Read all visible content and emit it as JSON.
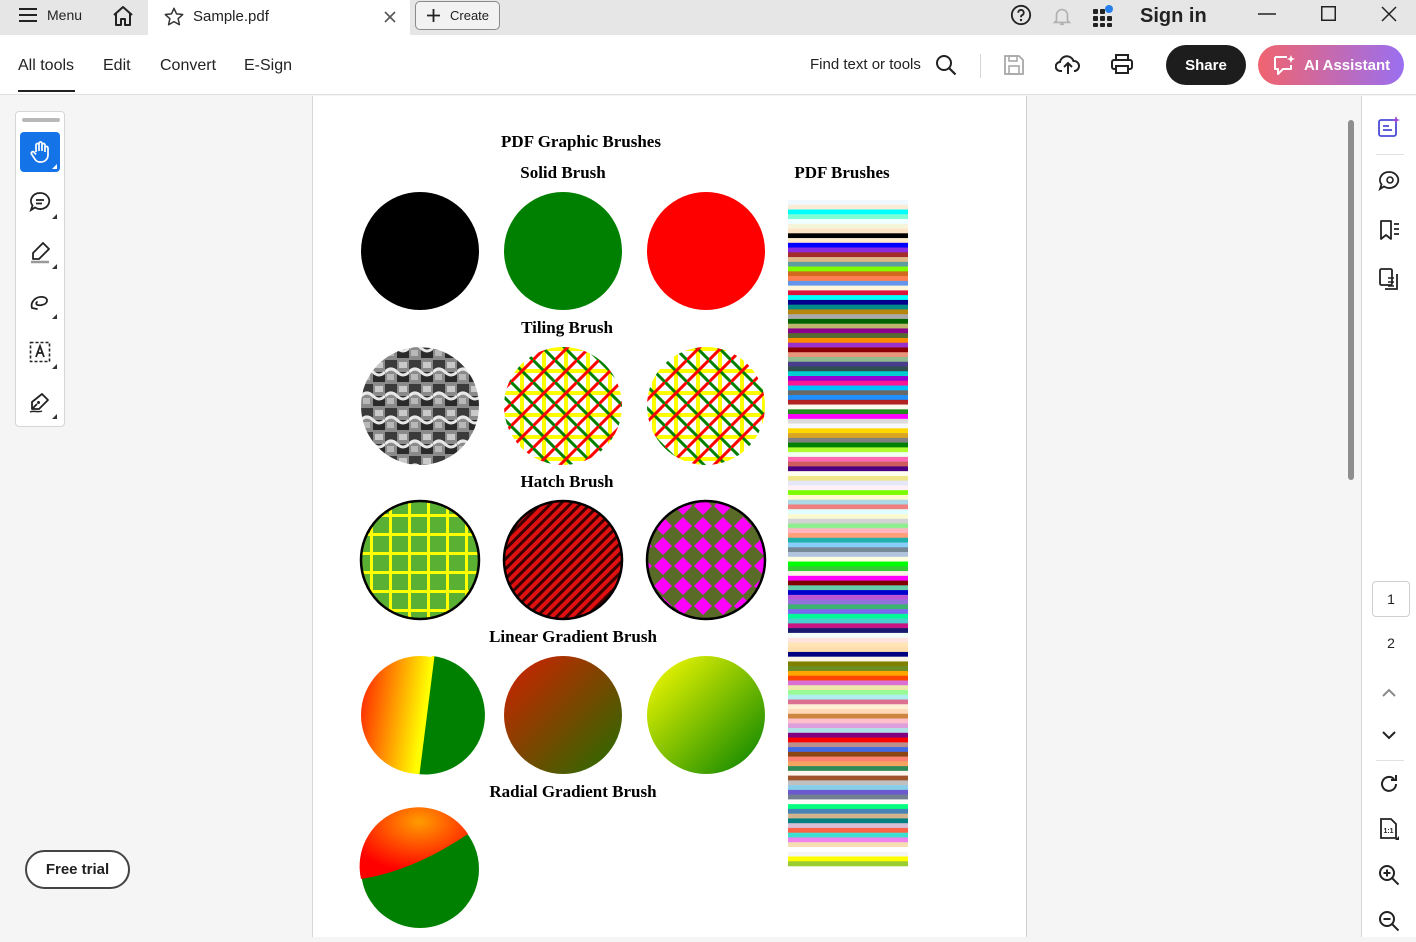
{
  "titlebar": {
    "menu_label": "Menu",
    "tab_label": "Sample.pdf",
    "create_label": "Create",
    "sign_in_label": "Sign in"
  },
  "toolbar": {
    "tabs": [
      {
        "label": "All tools",
        "active": true
      },
      {
        "label": "Edit",
        "active": false
      },
      {
        "label": "Convert",
        "active": false
      },
      {
        "label": "E-Sign",
        "active": false
      }
    ],
    "find_label": "Find text or tools",
    "share_label": "Share",
    "ai_label": "AI Assistant"
  },
  "left_panel": {
    "tools": [
      "hand-tool",
      "comment-tool",
      "highlight-tool",
      "draw-tool",
      "text-select-tool",
      "sign-tool"
    ],
    "free_trial_label": "Free trial"
  },
  "pdf": {
    "main_title": "PDF Graphic Brushes",
    "solid_title": "Solid Brush",
    "tiling_title": "Tiling Brush",
    "hatch_title": "Hatch Brush",
    "linear_title": "Linear Gradient Brush",
    "radial_title": "Radial Gradient Brush",
    "brushes_title": "PDF Brushes",
    "solid_colors": [
      "#000000",
      "#008000",
      "#ff0000"
    ],
    "stripe_colors": [
      "#f0f8ff",
      "#faebd7",
      "#00ffff",
      "#7fffd4",
      "#f0ffff",
      "#f5f5dc",
      "#ffe4c4",
      "#000000",
      "#ffebcd",
      "#0000ff",
      "#8a2be2",
      "#a52a2a",
      "#deb887",
      "#5f9ea0",
      "#7fff00",
      "#d2691e",
      "#ff7f50",
      "#6495ed",
      "#fff8dc",
      "#dc143c",
      "#00ffff",
      "#00008b",
      "#008b8b",
      "#b8860b",
      "#a9a9a9",
      "#006400",
      "#bdb76b",
      "#8b008b",
      "#556b2f",
      "#ff8c00",
      "#9932cc",
      "#8b0000",
      "#e9967a",
      "#8fbc8f",
      "#483d8b",
      "#2f4f4f",
      "#00ced1",
      "#9400d3",
      "#ff1493",
      "#00bfff",
      "#696969",
      "#1e90ff",
      "#b22222",
      "#fffaf0",
      "#228b22",
      "#ff00ff",
      "#dcdcdc",
      "#f8f8ff",
      "#ffd700",
      "#daa520",
      "#808080",
      "#008000",
      "#adff2f",
      "#f0fff0",
      "#ff69b4",
      "#cd5c5c",
      "#4b0082",
      "#fffff0",
      "#f0e68c",
      "#e6e6fa",
      "#fff0f5",
      "#7cfc00",
      "#fffacd",
      "#add8e6",
      "#f08080",
      "#e0ffff",
      "#fafad2",
      "#d3d3d3",
      "#90ee90",
      "#ffb6c1",
      "#ffa07a",
      "#20b2aa",
      "#87cefa",
      "#778899",
      "#b0c4de",
      "#ffffe0",
      "#00ff00",
      "#32cd32",
      "#faf0e6",
      "#ff00ff",
      "#800000",
      "#66cdaa",
      "#0000cd",
      "#ba55d3",
      "#9370db",
      "#3cb371",
      "#7b68ee",
      "#00fa9a",
      "#48d1cc",
      "#c71585",
      "#191970",
      "#f5fffa",
      "#ffe4e1",
      "#ffe4b5",
      "#ffdead",
      "#000080",
      "#fdf5e6",
      "#808000",
      "#6b8e23",
      "#ffa500",
      "#ff4500",
      "#da70d6",
      "#eee8aa",
      "#98fb98",
      "#afeeee",
      "#db7093",
      "#ffefd5",
      "#ffdab9",
      "#cd853f",
      "#ffc0cb",
      "#dda0dd",
      "#b0e0e6",
      "#800080",
      "#ff0000",
      "#bc8f8f",
      "#4169e1",
      "#8b4513",
      "#fa8072",
      "#f4a460",
      "#2e8b57",
      "#fff5ee",
      "#a0522d",
      "#c0c0c0",
      "#87ceeb",
      "#6a5acd",
      "#708090",
      "#fffafa",
      "#00ff7f",
      "#4682b4",
      "#d2b48c",
      "#008080",
      "#d8bfd8",
      "#ff6347",
      "#40e0d0",
      "#ee82ee",
      "#f5deb3",
      "#ffffff",
      "#f5f5f5",
      "#ffff00",
      "#9acd32"
    ]
  },
  "right_rail": {
    "page_current": "1",
    "page_next": "2"
  }
}
